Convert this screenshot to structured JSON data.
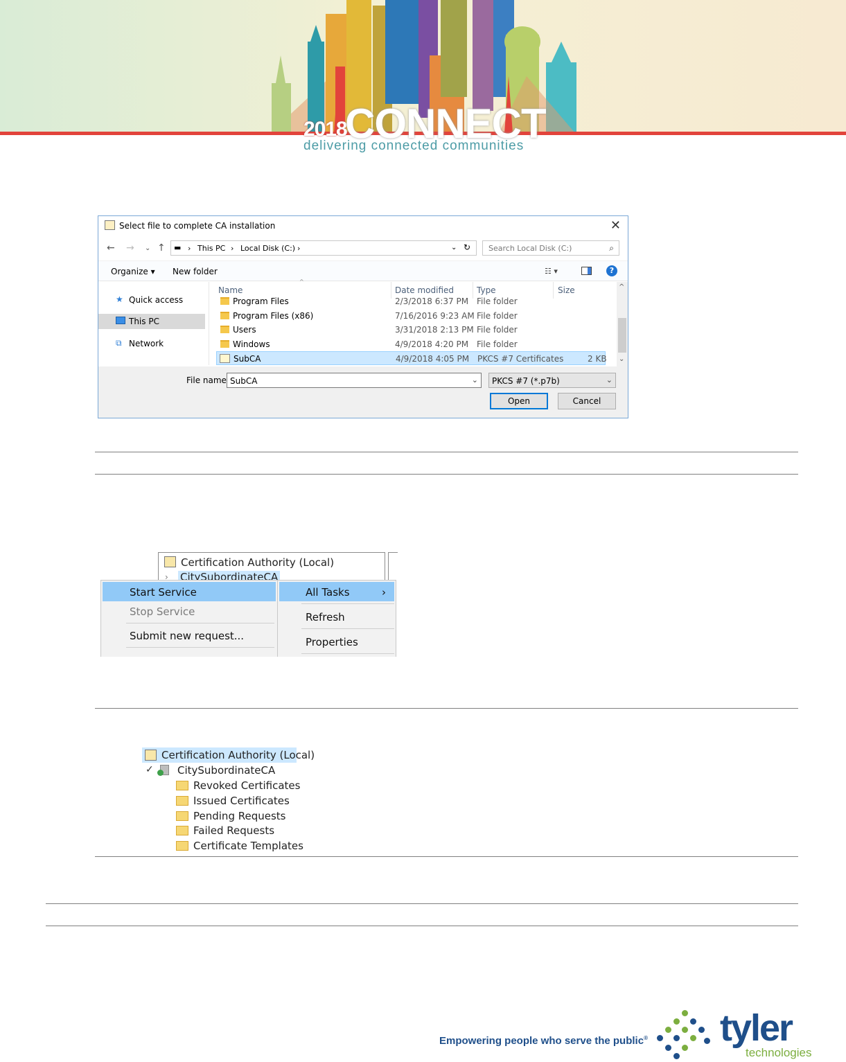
{
  "banner": {
    "year": "2018",
    "title": "CONNECT",
    "tagline": "delivering connected communities"
  },
  "dialog": {
    "title": "Select file to complete CA installation",
    "close_icon": "close-icon",
    "address": [
      "This PC",
      "Local Disk (C:)"
    ],
    "search_placeholder": "Search Local Disk (C:)",
    "toolbar": {
      "organize": "Organize",
      "new_folder": "New folder",
      "help": "?"
    },
    "nav_items": [
      {
        "label": "Quick access",
        "icon": "star-icon"
      },
      {
        "label": "This PC",
        "icon": "computer-icon",
        "selected": true
      },
      {
        "label": "Network",
        "icon": "network-icon"
      }
    ],
    "columns": [
      "Name",
      "Date modified",
      "Type",
      "Size"
    ],
    "files": [
      {
        "name": "Program Files",
        "date": "2/3/2018 6:37 PM",
        "type": "File folder",
        "size": ""
      },
      {
        "name": "Program Files (x86)",
        "date": "7/16/2016 9:23 AM",
        "type": "File folder",
        "size": ""
      },
      {
        "name": "Users",
        "date": "3/31/2018 2:13 PM",
        "type": "File folder",
        "size": ""
      },
      {
        "name": "Windows",
        "date": "4/9/2018 4:20 PM",
        "type": "File folder",
        "size": ""
      },
      {
        "name": "SubCA",
        "date": "4/9/2018 4:05 PM",
        "type": "PKCS #7 Certificates",
        "size": "2 KB",
        "selected": true
      }
    ],
    "file_name_label": "File name:",
    "file_name_value": "SubCA",
    "file_type_value": "PKCS #7 (*.p7b)",
    "open_label": "Open",
    "cancel_label": "Cancel"
  },
  "context_menu": {
    "tree_root": "Certification Authority (Local)",
    "tree_child": "CitySubordinateCA",
    "menu_left": [
      "Start Service",
      "Stop Service",
      "Submit new request..."
    ],
    "menu_right": [
      "All Tasks",
      "Refresh",
      "Properties"
    ]
  },
  "ca_tree": {
    "root": "Certification Authority (Local)",
    "server": "CitySubordinateCA",
    "folders": [
      "Revoked Certificates",
      "Issued Certificates",
      "Pending Requests",
      "Failed Requests",
      "Certificate Templates"
    ]
  },
  "footer": {
    "slogan": "Empowering people who serve the public",
    "registered_mark": "®",
    "brand": "tyler",
    "brand_sub": "technologies"
  },
  "colors": {
    "accent_blue": "#0078d7",
    "selection": "#cce8ff",
    "menu_highlight": "#91c9f7",
    "brand_blue": "#1f4f8a",
    "brand_green": "#7cae3f",
    "banner_red": "#e2433b"
  }
}
